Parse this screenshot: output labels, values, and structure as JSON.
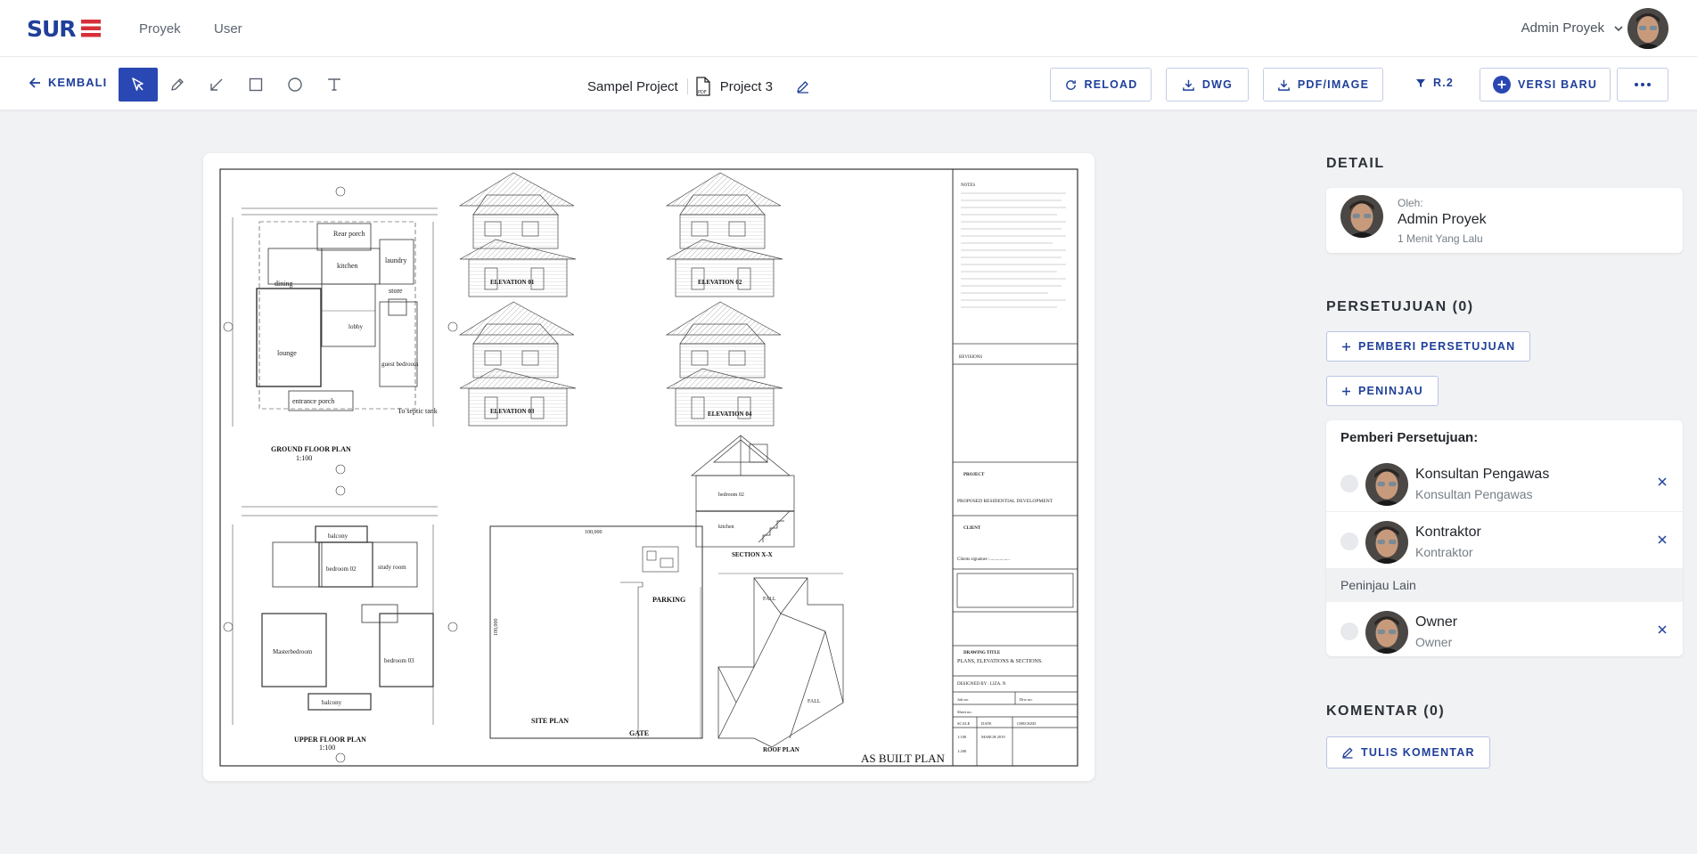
{
  "nav": {
    "brand": "SURE",
    "links": [
      "Proyek",
      "User"
    ],
    "user_name": "Admin Proyek"
  },
  "toolbar": {
    "back_label": "KEMBALI",
    "tools": [
      "select-icon",
      "pencil-icon",
      "arrow-line-icon",
      "rectangle-icon",
      "circle-icon",
      "text-icon"
    ],
    "active_tool": "select-icon",
    "project_name": "Sampel Project",
    "file_name": "Project 3",
    "reload_label": "RELOAD",
    "dwg_label": "DWG",
    "pdf_label": "PDF/IMAGE",
    "revision_label": "R.2",
    "new_version_label": "VERSI BARU",
    "more_icon": "more-horizontal-icon"
  },
  "drawing": {
    "ground_plan": "GROUND FLOOR PLAN",
    "upper_plan": "UPPER FLOOR PLAN",
    "scale": "1:100",
    "elev1": "ELEVATION 01",
    "elev2": "ELEVATION 02",
    "elev3": "ELEVATION 03",
    "elev4": "ELEVATION 04",
    "section": "SECTION X-X",
    "site": "SITE PLAN",
    "parking": "PARKING",
    "gate": "GATE",
    "roof": "ROOF PLAN",
    "as_built": "AS BUILT PLAN",
    "rooms_ground": [
      "Rear porch",
      "laundry",
      "kitchen",
      "dining",
      "store",
      "lobby",
      "lounge",
      "guest bedroom",
      "entrance porch",
      "To septic tank"
    ],
    "rooms_upper": [
      "balcony",
      "bedroom 02",
      "study room",
      "Masterbedroom",
      "bedroom 03",
      "balcony"
    ],
    "notes_title": "NOTES",
    "revisions_title": "REVISIONS",
    "project_title": "PROJECT",
    "project_value": "PROPOSED RESIDENTIAL DEVELOPMENT",
    "client_title": "CLIENT",
    "client_signature": "Clients signature :..................",
    "drawing_title": "DRAWING TITLE",
    "drawing_value": "PLANS, ELEVATIONS & SECTIONS.",
    "designed_by": "DESIGNED BY : LIZA. N",
    "job_no": "Job no.",
    "drw_no": "Drw no.",
    "sheet_no": "Sheet no.",
    "tb_scale": "SCALE",
    "tb_date": "DATE",
    "tb_checked": "CHECKED",
    "tb_scale_val": "1:100",
    "tb_date_val": "MARCH 2019",
    "tb_scale_val2": "1:200",
    "dim_site": "100,000",
    "dim_site_v": "100,000"
  },
  "detail": {
    "title": "DETAIL",
    "by_label": "Oleh:",
    "by_name": "Admin Proyek",
    "time": "1 Menit Yang Lalu"
  },
  "approval": {
    "title": "PERSETUJUAN (0)",
    "add_approver_label": "PEMBERI PERSETUJUAN",
    "add_reviewer_label": "PENINJAU",
    "approvers_heading": "Pemberi Persetujuan:",
    "approvers": [
      {
        "name": "Konsultan Pengawas",
        "role": "Konsultan Pengawas"
      },
      {
        "name": "Kontraktor",
        "role": "Kontraktor"
      }
    ],
    "others_heading": "Peninjau Lain",
    "others": [
      {
        "name": "Owner",
        "role": "Owner"
      }
    ]
  },
  "comments": {
    "title": "KOMENTAR (0)",
    "write_label": "TULIS KOMENTAR"
  },
  "colors": {
    "accent": "#1f3f9a",
    "active_tool": "#2a48b3",
    "logo_blue": "#1f3f9a",
    "logo_red": "#d62f3a"
  }
}
